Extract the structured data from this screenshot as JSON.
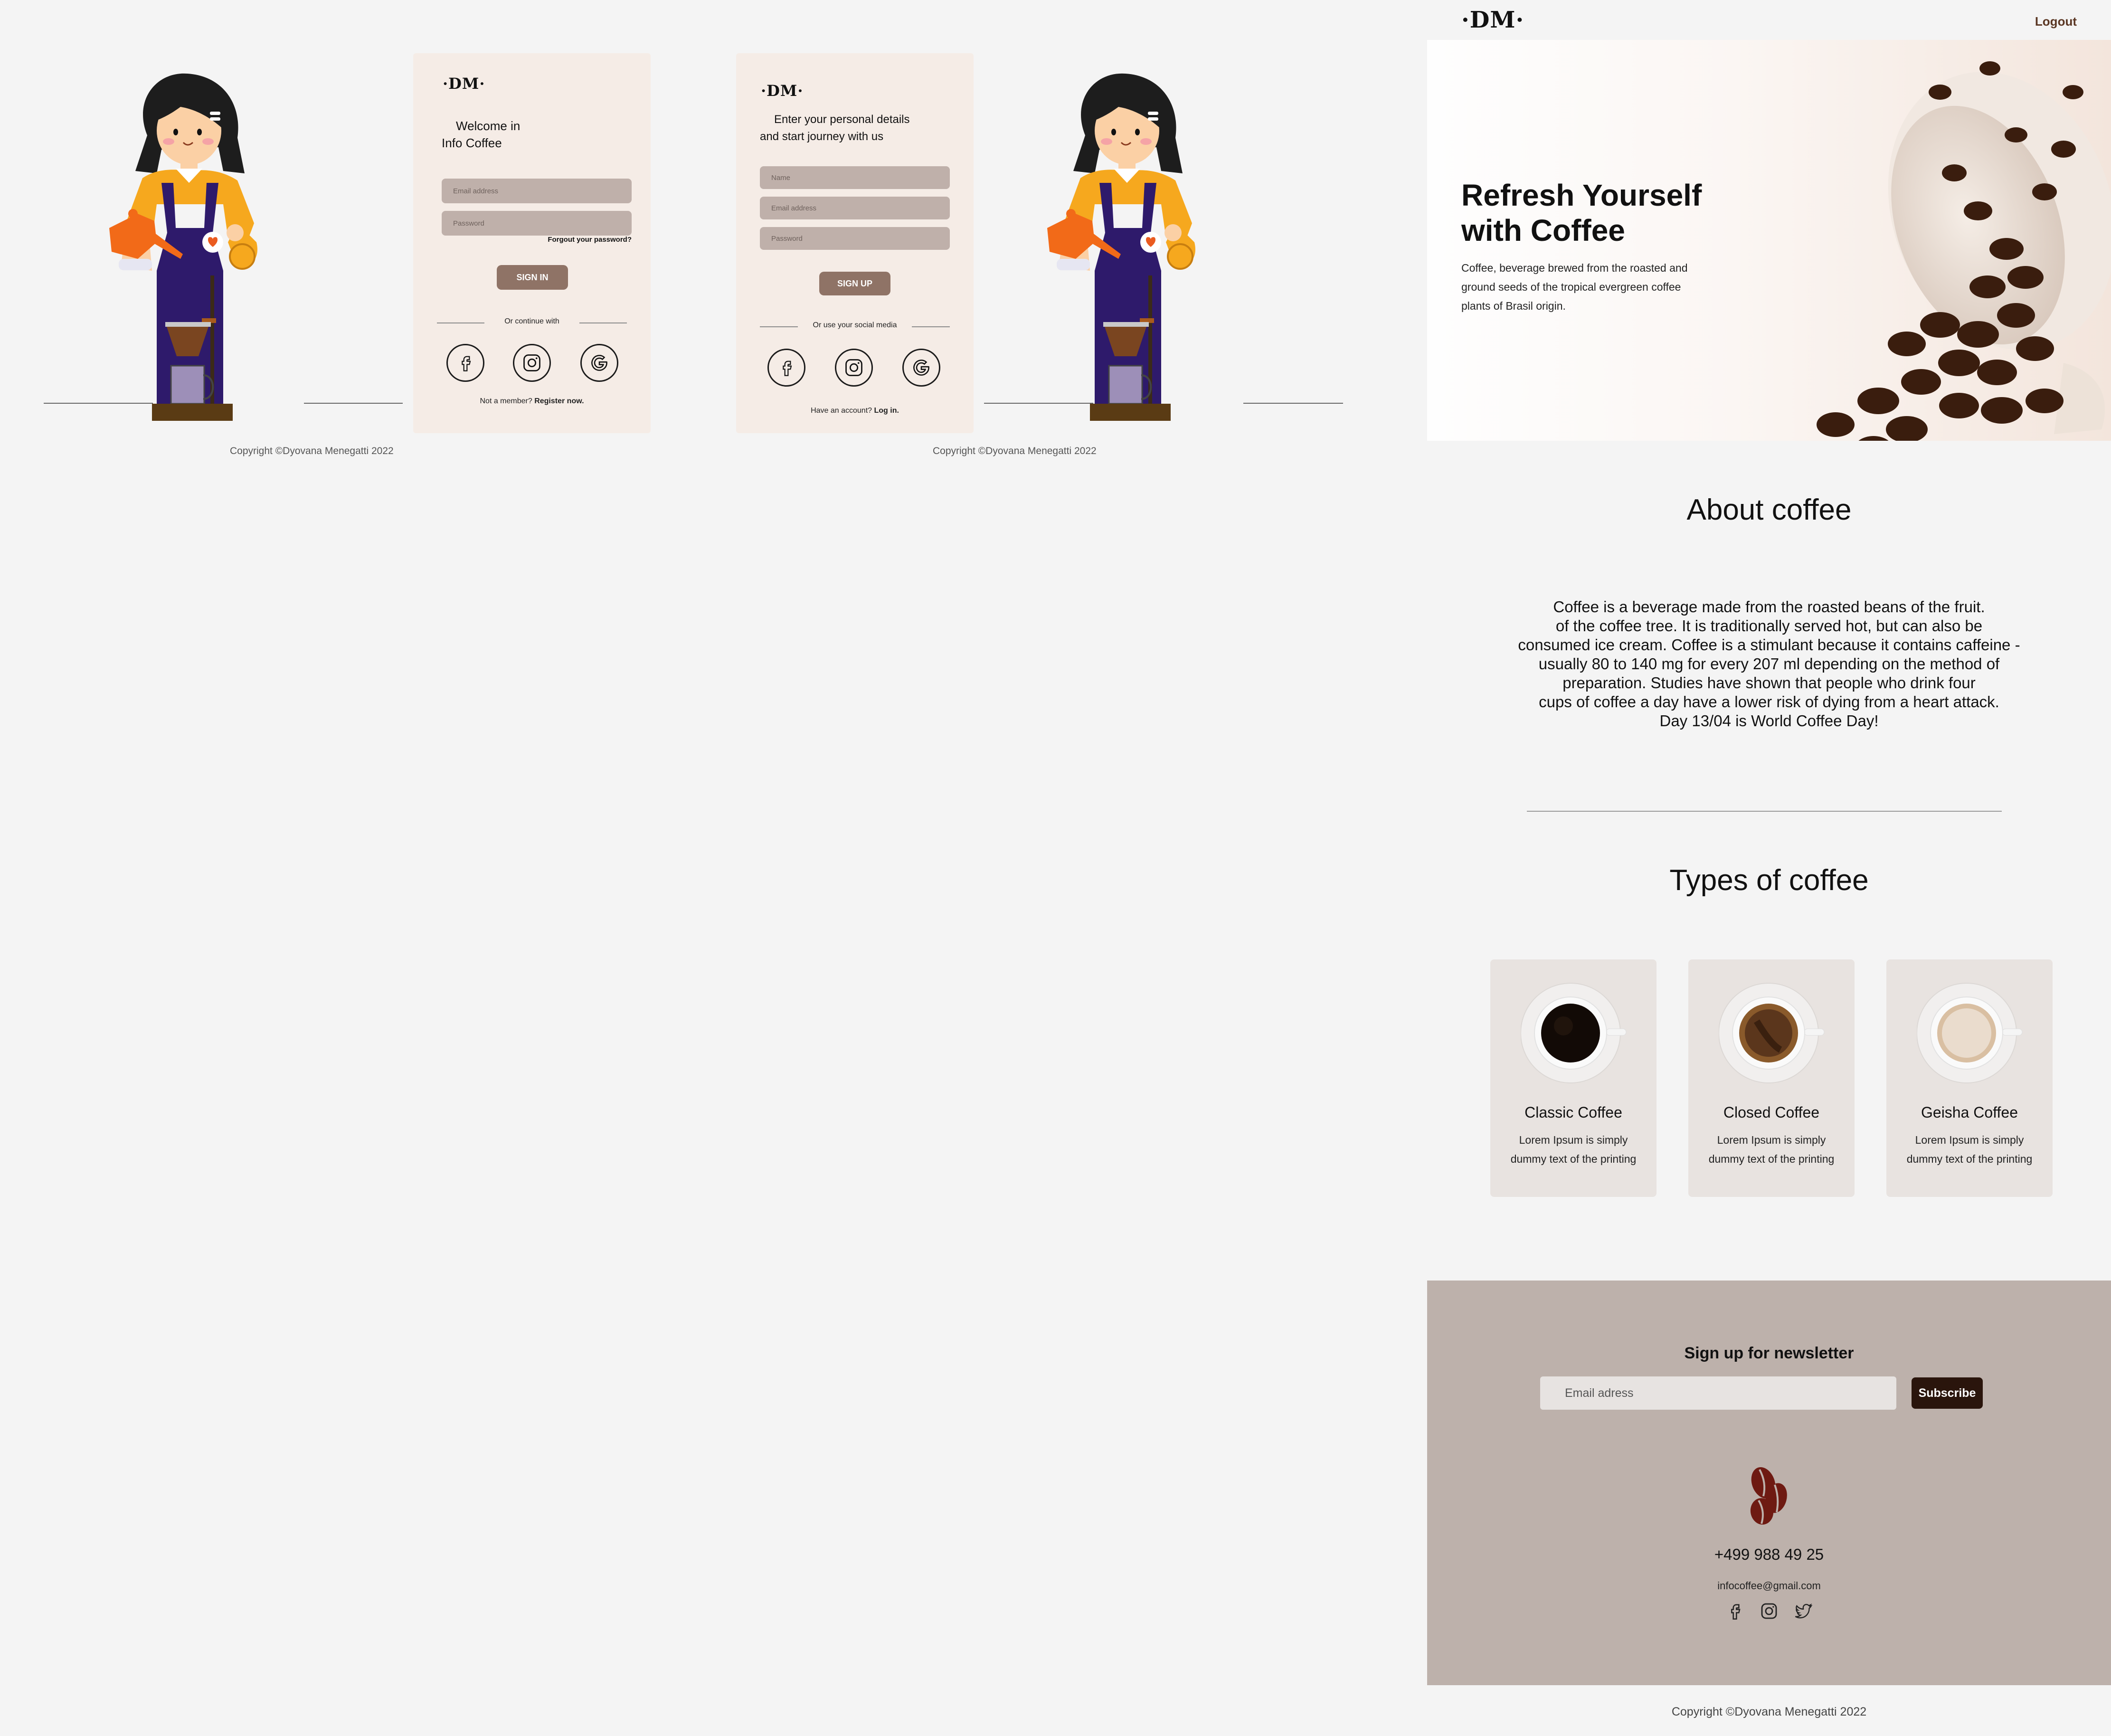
{
  "login": {
    "logo": "·DM·",
    "welcome_line1": "Welcome in",
    "welcome_line2": "Info Coffee",
    "email_placeholder": "Email address",
    "password_placeholder": "Password",
    "forgot_password": "Forgout your password?",
    "sign_in": "SIGN IN",
    "continue_with": "Or continue with",
    "not_member": "Not a member?",
    "register": "Register now.",
    "copyright": "Copyright  ©Dyovana Menegatti 2022"
  },
  "signup": {
    "logo": "·DM·",
    "intro_line1": "Enter your personal details",
    "intro_line2": "and start journey with us",
    "name_placeholder": "Name",
    "email_placeholder": "Email address",
    "password_placeholder": "Password",
    "sign_up": "SIGN UP",
    "social_media": "Or use your social media",
    "have_account": "Have an account?",
    "login": "Log in.",
    "copyright": "Copyright  ©Dyovana Menegatti 2022"
  },
  "landing": {
    "logo": "·DM·",
    "logout": "Logout",
    "hero_title_line1": "Refresh Yourself",
    "hero_title_line2": "with Coffee",
    "hero_text_line1": "Coffee, beverage brewed from the roasted and",
    "hero_text_line2": "ground seeds of the tropical evergreen coffee",
    "hero_text_line3": "plants of Brasil origin.",
    "about_title": "About coffee",
    "about_lines": [
      "Coffee is a beverage made from the roasted beans of the fruit.",
      "of the coffee tree. It is traditionally served hot, but can also be",
      "consumed ice cream. Coffee is a stimulant because it contains caffeine -",
      "usually 80 to 140 mg for every 207 ml depending on the method of",
      "preparation. Studies have shown that people who drink four",
      "cups of coffee a day have a lower risk of dying from a heart attack.",
      "Day 13/04 is World Coffee Day!"
    ],
    "types_title": "Types of coffee",
    "types": [
      {
        "name": "Classic Coffee",
        "desc1": "Lorem Ipsum is simply",
        "desc2": "dummy text of the printing",
        "color": "#120a06"
      },
      {
        "name": "Closed Coffee",
        "desc1": "Lorem Ipsum is simply",
        "desc2": "dummy text of the printing",
        "color": "#5b361c"
      },
      {
        "name": "Geisha Coffee",
        "desc1": "Lorem Ipsum is simply",
        "desc2": "dummy text of the printing",
        "color": "#eadccd"
      }
    ],
    "newsletter_title": "Sign up for newsletter",
    "newsletter_placeholder": "Email adress",
    "subscribe": "Subscribe",
    "phone": "+499 988 49 25",
    "email": "infocoffee@gmail.com",
    "copyright": "Copyright  ©Dyovana Menegatti 2022"
  },
  "colors": {
    "card_bg": "#f5ece6",
    "field_bg": "#bfb0aa",
    "button_brown": "#8f7366",
    "footer_bg": "#bdb1ab",
    "subscribe_bg": "#2a150c",
    "apron": "#2e1a6b",
    "shirt": "#f6a81e",
    "kettle": "#f26a18"
  }
}
